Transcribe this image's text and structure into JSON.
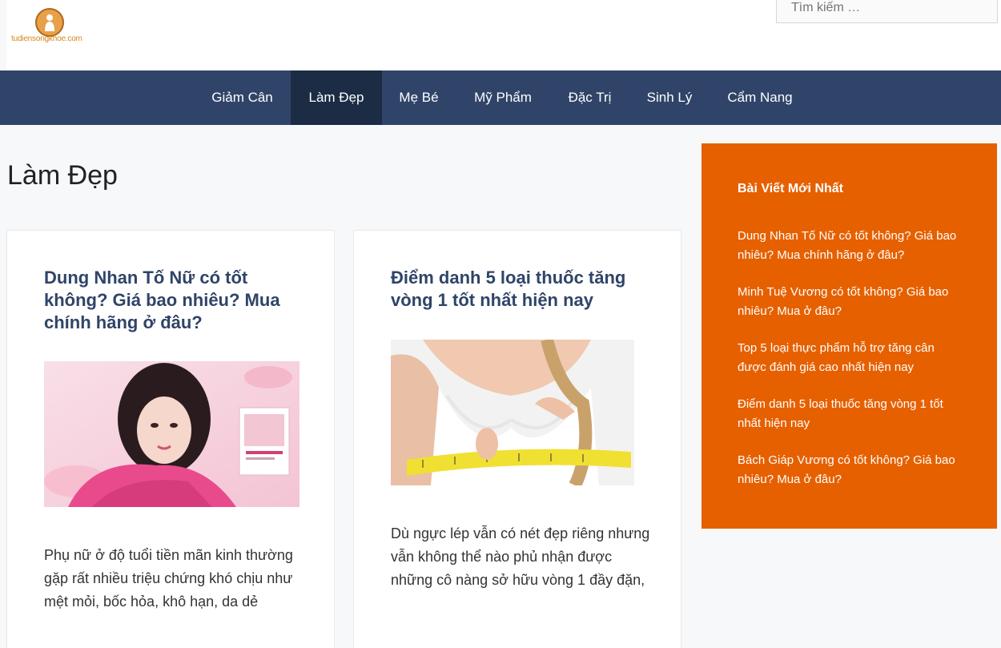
{
  "header": {
    "logo_text": "tudiensongkhoe.com",
    "search_placeholder": "Tìm kiếm …"
  },
  "nav": {
    "items": [
      "Giảm Cân",
      "Làm Đẹp",
      "Mẹ Bé",
      "Mỹ Phẩm",
      "Đặc Trị",
      "Sinh Lý",
      "Cẩm Nang"
    ],
    "active": "Làm Đẹp"
  },
  "page": {
    "title": "Làm Đẹp"
  },
  "posts": [
    {
      "title": "Dung Nhan Tố Nữ có tốt không? Giá bao nhiêu? Mua chính hãng ở đâu?",
      "excerpt": "Phụ nữ ở độ tuổi tiền mãn kinh thường gặp rất nhiều triệu chứng khó chịu như mệt mỏi, bốc hỏa, khô hạn, da dẻ"
    },
    {
      "title": "Điểm danh 5 loại thuốc tăng vòng 1 tốt nhất hiện nay",
      "excerpt": "Dù ngực lép vẫn có nét đẹp riêng nhưng vẫn không thể nào phủ nhận được những cô nàng sở hữu vòng 1 đầy đặn,"
    }
  ],
  "sidebar": {
    "widget_title": "Bài Viết Mới Nhất",
    "recent_posts": [
      "Dung Nhan Tố Nữ có tốt không? Giá bao nhiêu? Mua chính hãng ở đâu?",
      "Minh Tuệ Vương có tốt không? Giá bao nhiêu? Mua ở đâu?",
      "Top 5 loại thực phẩm hỗ trợ tăng cân được đánh giá cao nhất hiện nay",
      "Điểm danh 5 loại thuốc tăng vòng 1 tốt nhất hiện nay",
      "Bách Giáp Vương có tốt không? Giá bao nhiêu? Mua ở đâu?"
    ]
  },
  "colors": {
    "nav_bg": "#2f4468",
    "nav_active_bg": "#1b2c44",
    "title_color": "#2f4468",
    "sidebar_bg": "#e66000"
  }
}
